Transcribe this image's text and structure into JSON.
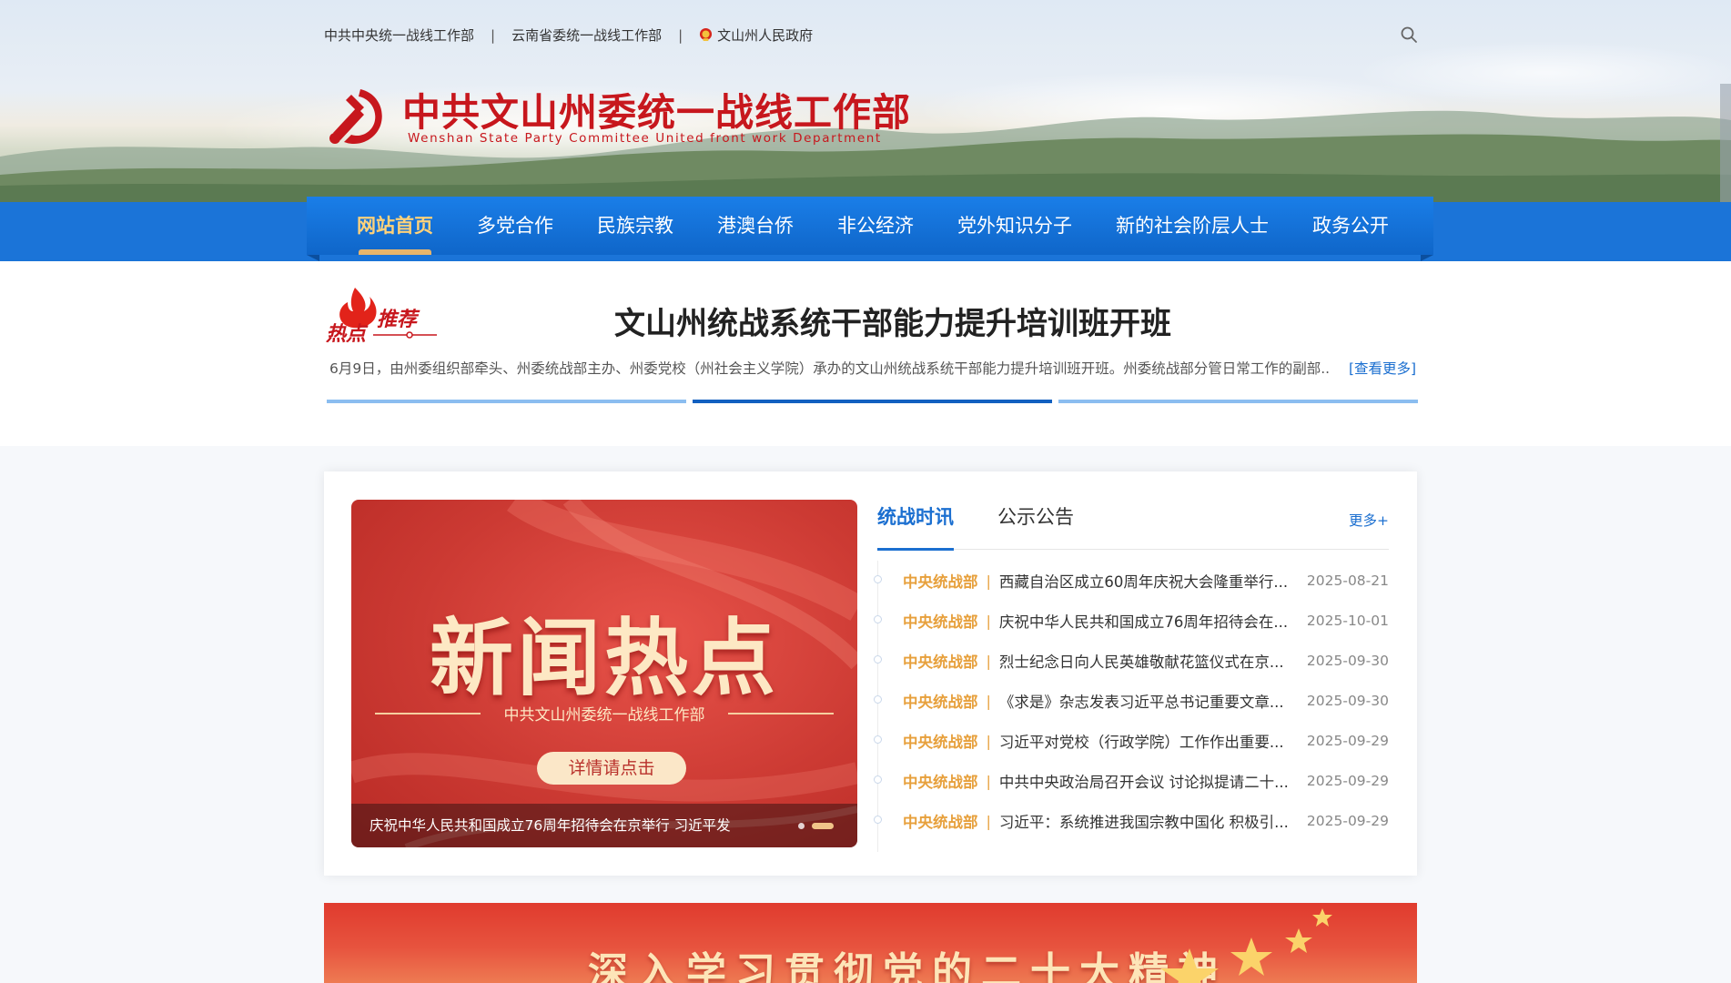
{
  "topbar": {
    "links": [
      "中共中央统一战线工作部",
      "云南省委统一战线工作部",
      "文山州人民政府"
    ],
    "separator": "|"
  },
  "site": {
    "title": "中共文山州委统一战线工作部",
    "subtitle": "Wenshan State Party Committee United front work Department"
  },
  "nav": {
    "items": [
      "网站首页",
      "多党合作",
      "民族宗教",
      "港澳台侨",
      "非公经济",
      "党外知识分子",
      "新的社会阶层人士",
      "政务公开"
    ],
    "active_index": 0
  },
  "hot": {
    "headline": "文山州统战系统干部能力提升培训班开班",
    "summary": "6月9日，由州委组织部牵头、州委统战部主办、州委党校（州社会主义学院）承办的文山州统战系统干部能力提升培训班开班。州委统战部分管日常工作的副部..",
    "more": "[查看更多]",
    "active_bar": 1,
    "bar_count": 3
  },
  "slideshow": {
    "big_text": "新闻热点",
    "org_text": "中共文山州委统一战线工作部",
    "button": "详情请点击",
    "caption": "庆祝中华人民共和国成立76周年招待会在京举行 习近平发",
    "active_dot": 1
  },
  "news": {
    "tabs": [
      "统战时讯",
      "公示公告"
    ],
    "active_tab": 0,
    "more": "更多+",
    "items": [
      {
        "source": "中央统战部",
        "title": "西藏自治区成立60周年庆祝大会隆重举行...",
        "date": "2025-08-21"
      },
      {
        "source": "中央统战部",
        "title": "庆祝中华人民共和国成立76周年招待会在...",
        "date": "2025-10-01"
      },
      {
        "source": "中央统战部",
        "title": "烈士纪念日向人民英雄敬献花篮仪式在京...",
        "date": "2025-09-30"
      },
      {
        "source": "中央统战部",
        "title": "《求是》杂志发表习近平总书记重要文章...",
        "date": "2025-09-30"
      },
      {
        "source": "中央统战部",
        "title": "习近平对党校（行政学院）工作作出重要...",
        "date": "2025-09-29"
      },
      {
        "source": "中央统战部",
        "title": "中共中央政治局召开会议 讨论拟提请二十...",
        "date": "2025-09-29"
      },
      {
        "source": "中央统战部",
        "title": "习近平：系统推进我国宗教中国化 积极引...",
        "date": "2025-09-29"
      }
    ]
  },
  "banner": {
    "text": "深入学习贯彻党的二十大精神"
  },
  "colors": {
    "brand_red": "#c7171d",
    "nav_blue": "#1b74d8",
    "link_blue": "#1b6fd0",
    "source_orange": "#e7a03c",
    "nav_active": "#ffd27a"
  },
  "icons": {
    "search": "search-icon",
    "emblem": "national-emblem-icon",
    "logo": "party-emblem-icon",
    "hot": "flame-icon"
  }
}
